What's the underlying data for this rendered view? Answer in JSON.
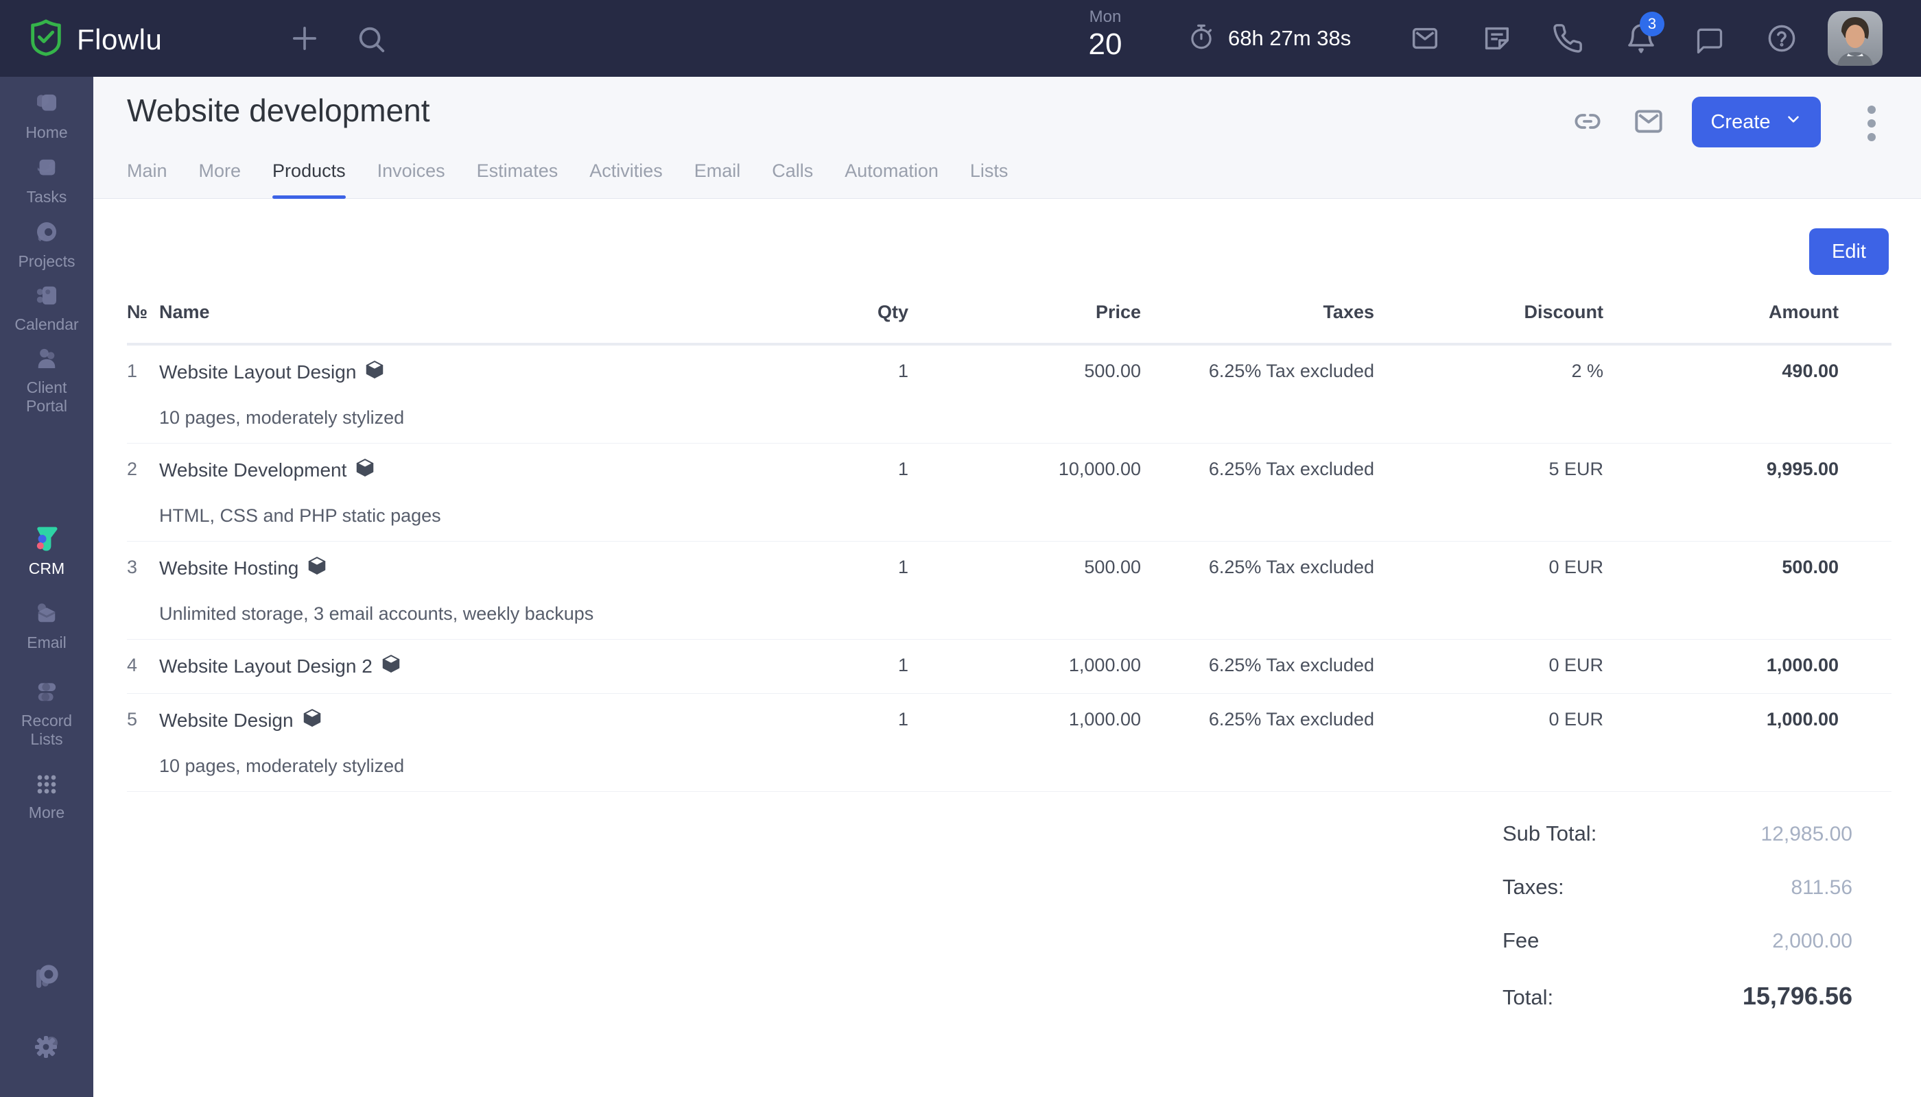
{
  "topbar": {
    "brand": "Flowlu",
    "date_day_name": "Mon",
    "date_day": "20",
    "timer": "68h 27m 38s",
    "notification_count": "3"
  },
  "sidebar": {
    "items": [
      {
        "label": "Home"
      },
      {
        "label": "Tasks"
      },
      {
        "label": "Projects"
      },
      {
        "label": "Calendar"
      },
      {
        "label": "Client Portal"
      },
      {
        "label": "CRM",
        "active": true
      },
      {
        "label": "Email"
      },
      {
        "label": "Record Lists"
      },
      {
        "label": "More"
      }
    ]
  },
  "header": {
    "title": "Website development",
    "tabs": [
      {
        "label": "Main"
      },
      {
        "label": "More"
      },
      {
        "label": "Products",
        "active": true
      },
      {
        "label": "Invoices"
      },
      {
        "label": "Estimates"
      },
      {
        "label": "Activities"
      },
      {
        "label": "Email"
      },
      {
        "label": "Calls"
      },
      {
        "label": "Automation"
      },
      {
        "label": "Lists"
      }
    ],
    "create_label": "Create"
  },
  "content": {
    "edit_label": "Edit",
    "table": {
      "columns": [
        "№",
        "Name",
        "Qty",
        "Price",
        "Taxes",
        "Discount",
        "Amount"
      ],
      "rows": [
        {
          "num": "1",
          "name": "Website Layout Design",
          "desc": "10 pages, moderately stylized",
          "qty": "1",
          "price": "500.00",
          "taxes": "6.25% Tax excluded",
          "discount": "2 %",
          "amount": "490.00"
        },
        {
          "num": "2",
          "name": "Website Development",
          "desc": "HTML, CSS and PHP static pages",
          "qty": "1",
          "price": "10,000.00",
          "taxes": "6.25% Tax excluded",
          "discount": "5 EUR",
          "amount": "9,995.00"
        },
        {
          "num": "3",
          "name": "Website Hosting",
          "desc": "Unlimited storage, 3 email accounts, weekly backups",
          "qty": "1",
          "price": "500.00",
          "taxes": "6.25% Tax excluded",
          "discount": "0 EUR",
          "amount": "500.00"
        },
        {
          "num": "4",
          "name": "Website Layout Design 2",
          "desc": "",
          "qty": "1",
          "price": "1,000.00",
          "taxes": "6.25% Tax excluded",
          "discount": "0 EUR",
          "amount": "1,000.00"
        },
        {
          "num": "5",
          "name": "Website Design",
          "desc": "10 pages, moderately stylized",
          "qty": "1",
          "price": "1,000.00",
          "taxes": "6.25% Tax excluded",
          "discount": "0 EUR",
          "amount": "1,000.00"
        }
      ]
    },
    "totals": [
      {
        "label": "Sub Total:",
        "value": "12,985.00"
      },
      {
        "label": "Taxes:",
        "value": "811.56"
      },
      {
        "label": "Fee",
        "value": "2,000.00"
      },
      {
        "label": "Total:",
        "value": "15,796.56"
      }
    ]
  },
  "colors": {
    "accent_blue": "#3d63e6",
    "badge_blue": "#2e6ceb",
    "brand_green": "#35b44a",
    "topbar_bg": "#262a44",
    "sidebar_bg": "#3c4160",
    "crm_teal": "#2ed3a5",
    "crm_pink": "#f2607a",
    "crm_blue": "#4064e8"
  }
}
